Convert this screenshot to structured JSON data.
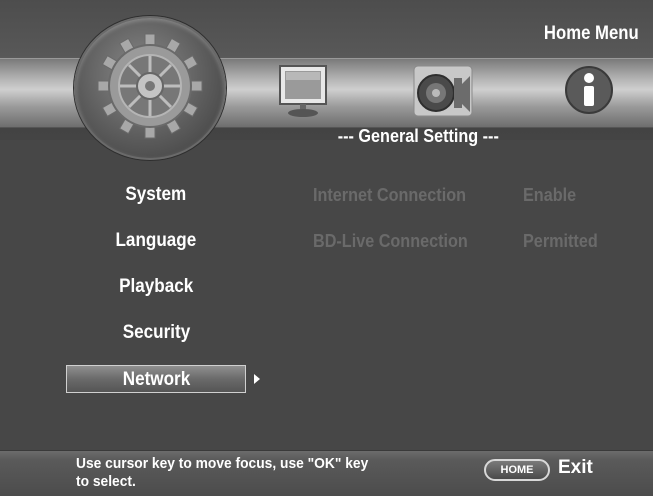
{
  "header": {
    "title": "Home Menu",
    "section_title": "--- General Setting ---"
  },
  "top_icons": [
    "gear-icon",
    "monitor-icon",
    "speaker-icon",
    "info-icon"
  ],
  "menu": {
    "items": [
      {
        "label": "System"
      },
      {
        "label": "Language"
      },
      {
        "label": "Playback"
      },
      {
        "label": "Security"
      },
      {
        "label": "Network",
        "selected": true
      }
    ]
  },
  "settings": [
    {
      "name": "Internet Connection",
      "value": "Enable"
    },
    {
      "name": "BD-Live Connection",
      "value": "Permitted"
    }
  ],
  "footer": {
    "hint": "Use cursor key to move focus, use \"OK\" key to select.",
    "home_key": "HOME",
    "exit_label": "Exit"
  },
  "colors": {
    "background": "#474747",
    "band": "#c4c4c4",
    "disabled_text": "#6a6a6a",
    "text": "#ffffff"
  }
}
